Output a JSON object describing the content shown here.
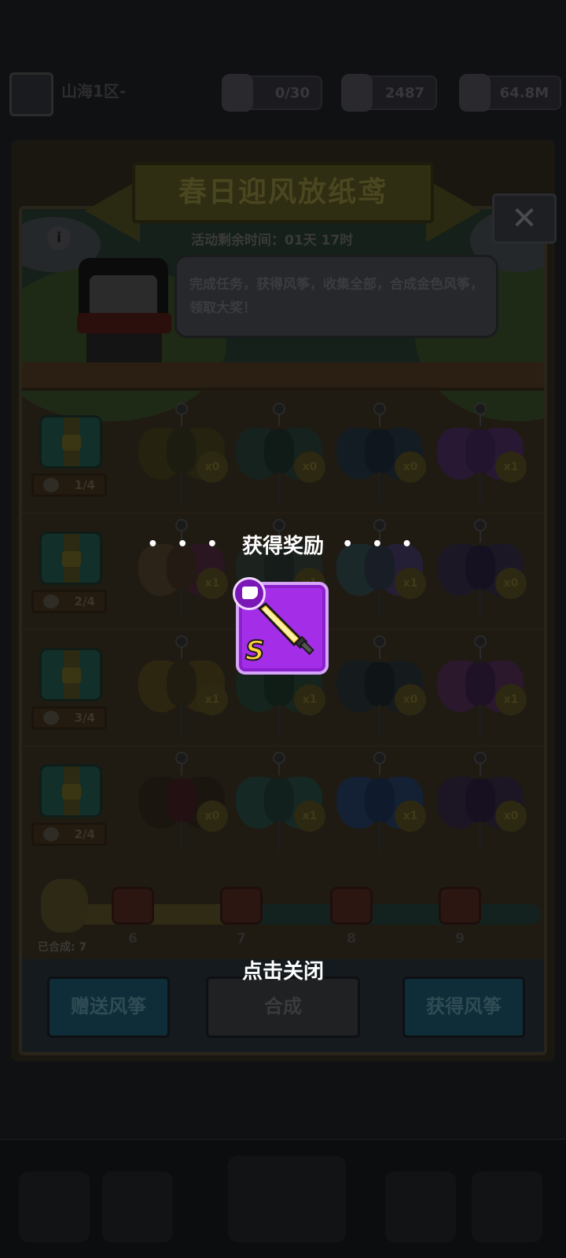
{
  "header": {
    "player_name": "山海1区-",
    "resources": [
      {
        "icon": "energy-icon",
        "value": "0/30"
      },
      {
        "icon": "gem-icon",
        "value": "2487"
      },
      {
        "icon": "coin-icon",
        "value": "64.8M"
      }
    ]
  },
  "event": {
    "title": "春日迎风放纸鸢",
    "timer": "活动剩余时间：01天 17时",
    "description": "完成任务，获得风筝，收集全部，合成金色风筝，领取大奖！",
    "close_symbol": "✕",
    "info_symbol": "i",
    "rows": [
      {
        "progress": "1/4",
        "counts": [
          "x0",
          "x0",
          "x0",
          "x1"
        ]
      },
      {
        "progress": "2/4",
        "counts": [
          "x1",
          "x1",
          "x1",
          "x0"
        ]
      },
      {
        "progress": "3/4",
        "counts": [
          "x1",
          "x1",
          "x0",
          "x1"
        ]
      },
      {
        "progress": "2/4",
        "counts": [
          "x0",
          "x1",
          "x1",
          "x0"
        ]
      }
    ],
    "milestones": [
      "6",
      "7",
      "8",
      "9"
    ],
    "merged_label": "已合成: 7",
    "merge_progress": 0.38,
    "buttons": {
      "gift": "赠送风筝",
      "merge": "合成",
      "obtain": "获得风筝"
    }
  },
  "reward_popup": {
    "dots_left": "• • •",
    "title": "获得奖励",
    "dots_right": "• • •",
    "item": {
      "name": "sword-icon",
      "grade": "S",
      "rarity_color": "#a42ee8"
    },
    "tap_to_close": "点击关闭"
  }
}
